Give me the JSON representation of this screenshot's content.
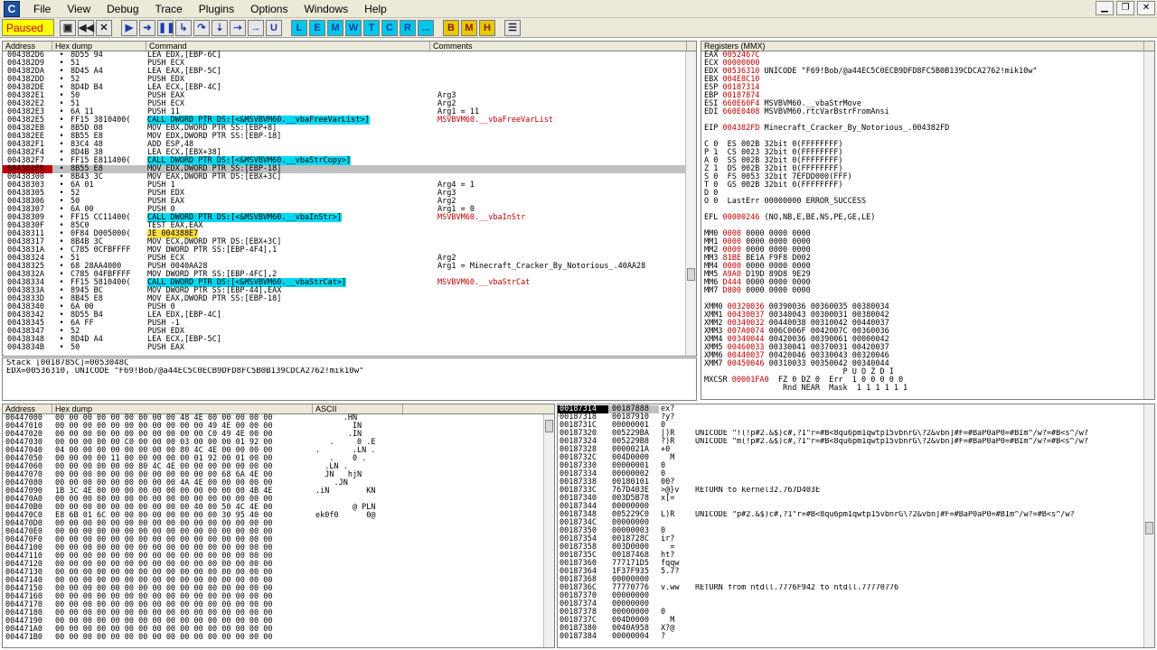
{
  "app": {
    "icon_letter": "C"
  },
  "menu": [
    "File",
    "View",
    "Debug",
    "Trace",
    "Plugins",
    "Options",
    "Windows",
    "Help"
  ],
  "toolbar": {
    "status": "Paused",
    "letters": [
      "L",
      "E",
      "M",
      "W",
      "T",
      "C",
      "R",
      "...",
      "B",
      "M",
      "H"
    ]
  },
  "cpu": {
    "headers": [
      "Address",
      "Hex dump",
      "Command",
      "Comments"
    ],
    "rows": [
      {
        "addr": "004382D6",
        "hex": "8D55 94",
        "cmd": "LEA EDX,[EBP-6C]",
        "cmt": ""
      },
      {
        "addr": "004382D9",
        "hex": "51",
        "cmd": "PUSH ECX",
        "cmt": ""
      },
      {
        "addr": "004382DA",
        "hex": "8D45 A4",
        "cmd": "LEA EAX,[EBP-5C]",
        "cmt": ""
      },
      {
        "addr": "004382DD",
        "hex": "52",
        "cmd": "PUSH EDX",
        "cmt": ""
      },
      {
        "addr": "004382DE",
        "hex": "8D4D B4",
        "cmd": "LEA ECX,[EBP-4C]",
        "cmt": ""
      },
      {
        "addr": "004382E1",
        "hex": "50",
        "cmd": "PUSH EAX",
        "cmt": "Arg3"
      },
      {
        "addr": "004382E2",
        "hex": "51",
        "cmd": "PUSH ECX",
        "cmt": "Arg2"
      },
      {
        "addr": "004382E3",
        "hex": "6A 11",
        "cmd": "PUSH 11",
        "cmt": "Arg1 = 11"
      },
      {
        "addr": "004382E5",
        "hex": "FF15 3810400(",
        "cmd": "CALL DWORD PTR DS:[<&MSVBVM60.__vbaFreeVarList>]",
        "cmt": "MSVBVM60.__vbaFreeVarList",
        "hl": "call"
      },
      {
        "addr": "004382EB",
        "hex": "8B5D 08",
        "cmd": "MOV EBX,DWORD PTR SS:[EBP+8]",
        "cmt": ""
      },
      {
        "addr": "004382EE",
        "hex": "8B55 E8",
        "cmd": "MOV EDX,DWORD PTR SS:[EBP-18]",
        "cmt": ""
      },
      {
        "addr": "004382F1",
        "hex": "83C4 48",
        "cmd": "ADD ESP,48",
        "cmt": ""
      },
      {
        "addr": "004382F4",
        "hex": "8D4B 38",
        "cmd": "LEA ECX,[EBX+38]",
        "cmt": ""
      },
      {
        "addr": "004382F7",
        "hex": "FF15 E811400(",
        "cmd": "CALL DWORD PTR DS:[<&MSVBVM60.__vbaStrCopy>]",
        "cmt": "",
        "hl": "call"
      },
      {
        "addr": "004382FD",
        "hex": "8B55 E8",
        "cmd": "MOV EDX,DWORD PTR SS:[EBP-18]",
        "cmt": "",
        "eip": true
      },
      {
        "addr": "00438300",
        "hex": "8B43 3C",
        "cmd": "MOV EAX,DWORD PTR DS:[EBX+3C]",
        "cmt": ""
      },
      {
        "addr": "00438303",
        "hex": "6A 01",
        "cmd": "PUSH 1",
        "cmt": "Arg4 = 1"
      },
      {
        "addr": "00438305",
        "hex": "52",
        "cmd": "PUSH EDX",
        "cmt": "Arg3"
      },
      {
        "addr": "00438306",
        "hex": "50",
        "cmd": "PUSH EAX",
        "cmt": "Arg2"
      },
      {
        "addr": "00438307",
        "hex": "6A 00",
        "cmd": "PUSH 0",
        "cmt": "Arg1 = 0"
      },
      {
        "addr": "00438309",
        "hex": "FF15 CC11400(",
        "cmd": "CALL DWORD PTR DS:[<&MSVBVM60.__vbaInStr>]",
        "cmt": "MSVBVM60.__vbaInStr",
        "hl": "call"
      },
      {
        "addr": "0043830F",
        "hex": "85C0",
        "cmd": "TEST EAX,EAX",
        "cmt": ""
      },
      {
        "addr": "00438311",
        "hex": "0F84 D005000(",
        "cmd": "JE 004388E7",
        "cmt": "",
        "hl": "jmp"
      },
      {
        "addr": "00438317",
        "hex": "8B4B 3C",
        "cmd": "MOV ECX,DWORD PTR DS:[EBX+3C]",
        "cmt": ""
      },
      {
        "addr": "0043831A",
        "hex": "C785 0CFBFFFF",
        "cmd": "MOV DWORD PTR SS:[EBP-4F4],1",
        "cmt": ""
      },
      {
        "addr": "00438324",
        "hex": "51",
        "cmd": "PUSH ECX",
        "cmt": "Arg2"
      },
      {
        "addr": "00438325",
        "hex": "68 28AA4000",
        "cmd": "PUSH 0040AA28",
        "cmt": "Arg1 = Minecraft_Cracker_By_Notorious_.40AA28"
      },
      {
        "addr": "0043832A",
        "hex": "C785 04FBFFFF",
        "cmd": "MOV DWORD PTR SS:[EBP-4FC],2",
        "cmt": ""
      },
      {
        "addr": "00438334",
        "hex": "FF15 5810400(",
        "cmd": "CALL DWORD PTR DS:[<&MSVBVM60.__vbaStrCat>]",
        "cmt": "MSVBVM60.__vbaStrCat",
        "hl": "call"
      },
      {
        "addr": "0043833A",
        "hex": "8945 BC",
        "cmd": "MOV DWORD PTR SS:[EBP-44],EAX",
        "cmt": ""
      },
      {
        "addr": "0043833D",
        "hex": "8B45 E8",
        "cmd": "MOV EAX,DWORD PTR SS:[EBP-18]",
        "cmt": ""
      },
      {
        "addr": "00438340",
        "hex": "6A 00",
        "cmd": "PUSH 0",
        "cmt": ""
      },
      {
        "addr": "00438342",
        "hex": "8D55 B4",
        "cmd": "LEA EDX,[EBP-4C]",
        "cmt": ""
      },
      {
        "addr": "00438345",
        "hex": "6A FF",
        "cmd": "PUSH -1",
        "cmt": ""
      },
      {
        "addr": "00438347",
        "hex": "52",
        "cmd": "PUSH EDX",
        "cmt": ""
      },
      {
        "addr": "00438348",
        "hex": "8D4D A4",
        "cmd": "LEA ECX,[EBP-5C]",
        "cmt": ""
      },
      {
        "addr": "0043834B",
        "hex": "50",
        "cmd": "PUSH EAX",
        "cmt": ""
      }
    ],
    "info": [
      "Stack [0018785C]=0053048C",
      "EDX=00536310, UNICODE \"F69!Bob/@a44EC5C0ECB9DFD8FC5B0B139CDCA2762!mik10w\""
    ]
  },
  "registers": {
    "title": "Registers (MMX)",
    "lines": [
      "EAX 0052467C",
      "ECX 00000000",
      "EDX 00536310 UNICODE \"F69!Bob/@a44EC5C0ECB9DFD8FC5B0B139CDCA2762!mik10w\"",
      "EBX 004E8C10",
      "ESP 00187314",
      "EBP 00187874",
      "ESI 660E60F4 MSVBVM60.__vbaStrMove",
      "EDI 660E0408 MSVBVM60.rtcVarBstrFromAnsi",
      "",
      "EIP 004382FD Minecraft_Cracker_By_Notorious_.004382FD",
      "",
      "C 0  ES 002B 32bit 0(FFFFFFFF)",
      "P 1  CS 0023 32bit 0(FFFFFFFF)",
      "A 0  SS 002B 32bit 0(FFFFFFFF)",
      "Z 1  DS 002B 32bit 0(FFFFFFFF)",
      "S 0  FS 0053 32bit 7EFDD000(FFF)",
      "T 0  GS 002B 32bit 0(FFFFFFFF)",
      "D 0",
      "O 0  LastErr 00000000 ERROR_SUCCESS",
      "",
      "EFL 00000246 (NO,NB,E,BE,NS,PE,GE,LE)",
      "",
      "MM0 0000 0000 0000 0000",
      "MM1 0000 0000 0000 0000",
      "MM2 0000 0000 0000 0000",
      "MM3 81BE BE1A F9F8 D002",
      "MM4 0000 0000 0000 0000",
      "MM5 A9A0 D19D 89D8 9E29",
      "MM6 D444 0000 0000 0000",
      "MM7 D800 0000 0000 0000",
      "",
      "XMM0 00320036 00390036 00360035 00380034",
      "XMM1 00430037 00340043 00300031 00380042",
      "XMM2 00340032 00440038 00310042 00440037",
      "XMM3 007A0074 006C006F 0042007C 00360036",
      "XMM4 00340044 00420036 00390061 00000042",
      "XMM5 00460033 00330041 00370031 00420037",
      "XMM6 00440037 00420046 00330043 00320046",
      "XMM7 00450046 00310033 00350042 00340044",
      "                              P U O Z D I",
      "MXCSR 00001FA0  FZ 0 DZ 0  Err  1 0 0 0 0 0",
      "                 Rnd NEAR  Mask  1 1 1 1 1 1"
    ]
  },
  "dump": {
    "headers": [
      "Address",
      "Hex dump",
      "ASCII"
    ],
    "rows": [
      {
        "addr": "00447000",
        "hex": "00 00 00 00 00 00 00 00 00 48 4E 00 00 00 00 00",
        "ascii": "      .HN"
      },
      {
        "addr": "00447010",
        "hex": "00 00 00 00 00 00 00 00 00 00 00 49 4E 00 00 00",
        "ascii": "        IN"
      },
      {
        "addr": "00447020",
        "hex": "00 00 00 00 00 00 00 00 00 00 00 C0 49 4E 00 00",
        "ascii": "       .IN"
      },
      {
        "addr": "00447030",
        "hex": "00 00 00 00 00 C0 00 00 00 03 00 00 00 01 92 00",
        "ascii": "   .     0 .E"
      },
      {
        "addr": "00447040",
        "hex": "04 00 00 00 00 00 00 00 00 80 4C 4E 00 00 00 00",
        "ascii": ".       .LN ."
      },
      {
        "addr": "00447050",
        "hex": "00 00 00 00 11 00 00 00 00 00 01 92 00 01 00 00",
        "ascii": "   .    0 ."
      },
      {
        "addr": "00447060",
        "hex": "00 00 00 00 00 00 80 4C 4E 00 00 00 00 00 00 00",
        "ascii": "  .LN ."
      },
      {
        "addr": "00447070",
        "hex": "00 00 00 00 00 00 00 00 00 00 00 00 68 6A 4E 00",
        "ascii": "  JN   hjN"
      },
      {
        "addr": "00447080",
        "hex": "00 00 00 00 00 00 00 00 00 4A 4E 00 00 00 00 00",
        "ascii": "    .JN"
      },
      {
        "addr": "00447090",
        "hex": "1B 3C 4E 00 00 00 00 00 00 00 00 00 00 00 4B 4E",
        "ascii": ".iN        KN"
      },
      {
        "addr": "004470A0",
        "hex": "00 00 00 00 00 00 00 00 00 00 00 00 00 00 00 00",
        "ascii": ""
      },
      {
        "addr": "004470B0",
        "hex": "00 00 00 00 00 00 00 00 00 00 40 00 50 4C 4E 00",
        "ascii": "        @ PLN"
      },
      {
        "addr": "004470C0",
        "hex": "E8 6B 01 6C 00 00 00 00 00 00 00 00 30 95 40 00",
        "ascii": "ek0f0      0@"
      },
      {
        "addr": "004470D0",
        "hex": "00 00 00 00 00 00 00 00 00 00 00 00 00 00 00 00",
        "ascii": ""
      },
      {
        "addr": "004470E0",
        "hex": "00 00 00 00 00 00 00 00 00 00 00 00 00 00 00 00",
        "ascii": ""
      },
      {
        "addr": "004470F0",
        "hex": "00 00 00 00 00 00 00 00 00 00 00 00 00 00 00 00",
        "ascii": ""
      },
      {
        "addr": "00447100",
        "hex": "00 00 00 00 00 00 00 00 00 00 00 00 00 00 00 00",
        "ascii": ""
      },
      {
        "addr": "00447110",
        "hex": "00 00 00 00 00 00 00 00 00 00 00 00 00 00 00 00",
        "ascii": ""
      },
      {
        "addr": "00447120",
        "hex": "00 00 00 00 00 00 00 00 00 00 00 00 00 00 00 00",
        "ascii": ""
      },
      {
        "addr": "00447130",
        "hex": "00 00 00 00 00 00 00 00 00 00 00 00 00 00 00 00",
        "ascii": ""
      },
      {
        "addr": "00447140",
        "hex": "00 00 00 00 00 00 00 00 00 00 00 00 00 00 00 00",
        "ascii": ""
      },
      {
        "addr": "00447150",
        "hex": "00 00 00 00 00 00 00 00 00 00 00 00 00 00 00 00",
        "ascii": ""
      },
      {
        "addr": "00447160",
        "hex": "00 00 00 00 00 00 00 00 00 00 00 00 00 00 00 00",
        "ascii": ""
      },
      {
        "addr": "00447170",
        "hex": "00 00 00 00 00 00 00 00 00 00 00 00 00 00 00 00",
        "ascii": ""
      },
      {
        "addr": "00447180",
        "hex": "00 00 00 00 00 00 00 00 00 00 00 00 00 00 00 00",
        "ascii": ""
      },
      {
        "addr": "00447190",
        "hex": "00 00 00 00 00 00 00 00 00 00 00 00 00 00 00 00",
        "ascii": ""
      },
      {
        "addr": "004471A0",
        "hex": "00 00 00 00 00 00 00 00 00 00 00 00 00 00 00 00",
        "ascii": ""
      },
      {
        "addr": "004471B0",
        "hex": "00 00 00 00 00 00 00 00 00 00 00 00 00 00 00 00",
        "ascii": ""
      }
    ]
  },
  "stack": {
    "rows": [
      {
        "addr": "00187314",
        "val": "00187888",
        "asc": "ex?",
        "cmt": "",
        "sel": true
      },
      {
        "addr": "00187318",
        "val": "00187910",
        "asc": "?y?",
        "cmt": ""
      },
      {
        "addr": "0018731C",
        "val": "00000001",
        "asc": "0",
        "cmt": ""
      },
      {
        "addr": "00187320",
        "val": "005229BA",
        "asc": "|)R",
        "cmt": "UNICODE \"!(!p#2.&$)c#,?1\"r=#B<8qu6pm1qwtp15vbnrG\\?2&vbn]#F=#BaP0aP0=#BIm^/w?=#B<s^/w?"
      },
      {
        "addr": "00187324",
        "val": "005229B8",
        "asc": "?)R",
        "cmt": "UNICODE \"m(!p#2.&$)c#,?1\"r=#B<8qu6pm1qwtp15vbnrG\\?2&vbn]#F=#BaP0aP0=#BIm^/w?=#B<s^/w?"
      },
      {
        "addr": "00187328",
        "val": "0000021A",
        "asc": "+0",
        "cmt": ""
      },
      {
        "addr": "0018732C",
        "val": "004D0000",
        "asc": "  M",
        "cmt": ""
      },
      {
        "addr": "00187330",
        "val": "00000001",
        "asc": "0",
        "cmt": ""
      },
      {
        "addr": "00187334",
        "val": "00000002",
        "asc": "0",
        "cmt": ""
      },
      {
        "addr": "00187338",
        "val": "00180101",
        "asc": "00?",
        "cmt": ""
      },
      {
        "addr": "0018733C",
        "val": "767D403E",
        "asc": ">@}v",
        "cmt": "RETURN to kernel32.767D403E"
      },
      {
        "addr": "00187340",
        "val": "003D5B78",
        "asc": "x[=",
        "cmt": ""
      },
      {
        "addr": "00187344",
        "val": "00000000",
        "asc": "",
        "cmt": ""
      },
      {
        "addr": "00187348",
        "val": "005229C0",
        "asc": "L)R",
        "cmt": "UNICODE \"p#2.&$)c#,?1\"r=#B<8qu6pm1qwtp15vbnrG\\?2&vbn]#F=#BaP0aP0=#BIm^/w?=#B<s^/w?"
      },
      {
        "addr": "0018734C",
        "val": "00000000",
        "asc": "",
        "cmt": ""
      },
      {
        "addr": "00187350",
        "val": "00000003",
        "asc": "0",
        "cmt": ""
      },
      {
        "addr": "00187354",
        "val": "0018728C",
        "asc": "ir?",
        "cmt": ""
      },
      {
        "addr": "00187358",
        "val": "003D0000",
        "asc": "  =",
        "cmt": ""
      },
      {
        "addr": "0018735C",
        "val": "00187468",
        "asc": "ht?",
        "cmt": ""
      },
      {
        "addr": "00187360",
        "val": "777171D5",
        "asc": "fqqw",
        "cmt": ""
      },
      {
        "addr": "00187364",
        "val": "1F37F935",
        "asc": "5.7?",
        "cmt": ""
      },
      {
        "addr": "00187368",
        "val": "00000000",
        "asc": "",
        "cmt": ""
      },
      {
        "addr": "0018736C",
        "val": "77770776",
        "asc": "v.ww",
        "cmt": "RETURN from ntdll.7776F942 to ntdll.77770776"
      },
      {
        "addr": "00187370",
        "val": "00000000",
        "asc": "",
        "cmt": ""
      },
      {
        "addr": "00187374",
        "val": "00000000",
        "asc": "",
        "cmt": ""
      },
      {
        "addr": "00187378",
        "val": "00000000",
        "asc": "0",
        "cmt": ""
      },
      {
        "addr": "0018737C",
        "val": "004D0000",
        "asc": "  M",
        "cmt": ""
      },
      {
        "addr": "00187380",
        "val": "0040A958",
        "asc": "X?@",
        "cmt": ""
      },
      {
        "addr": "00187384",
        "val": "00000004",
        "asc": "?",
        "cmt": ""
      }
    ]
  }
}
